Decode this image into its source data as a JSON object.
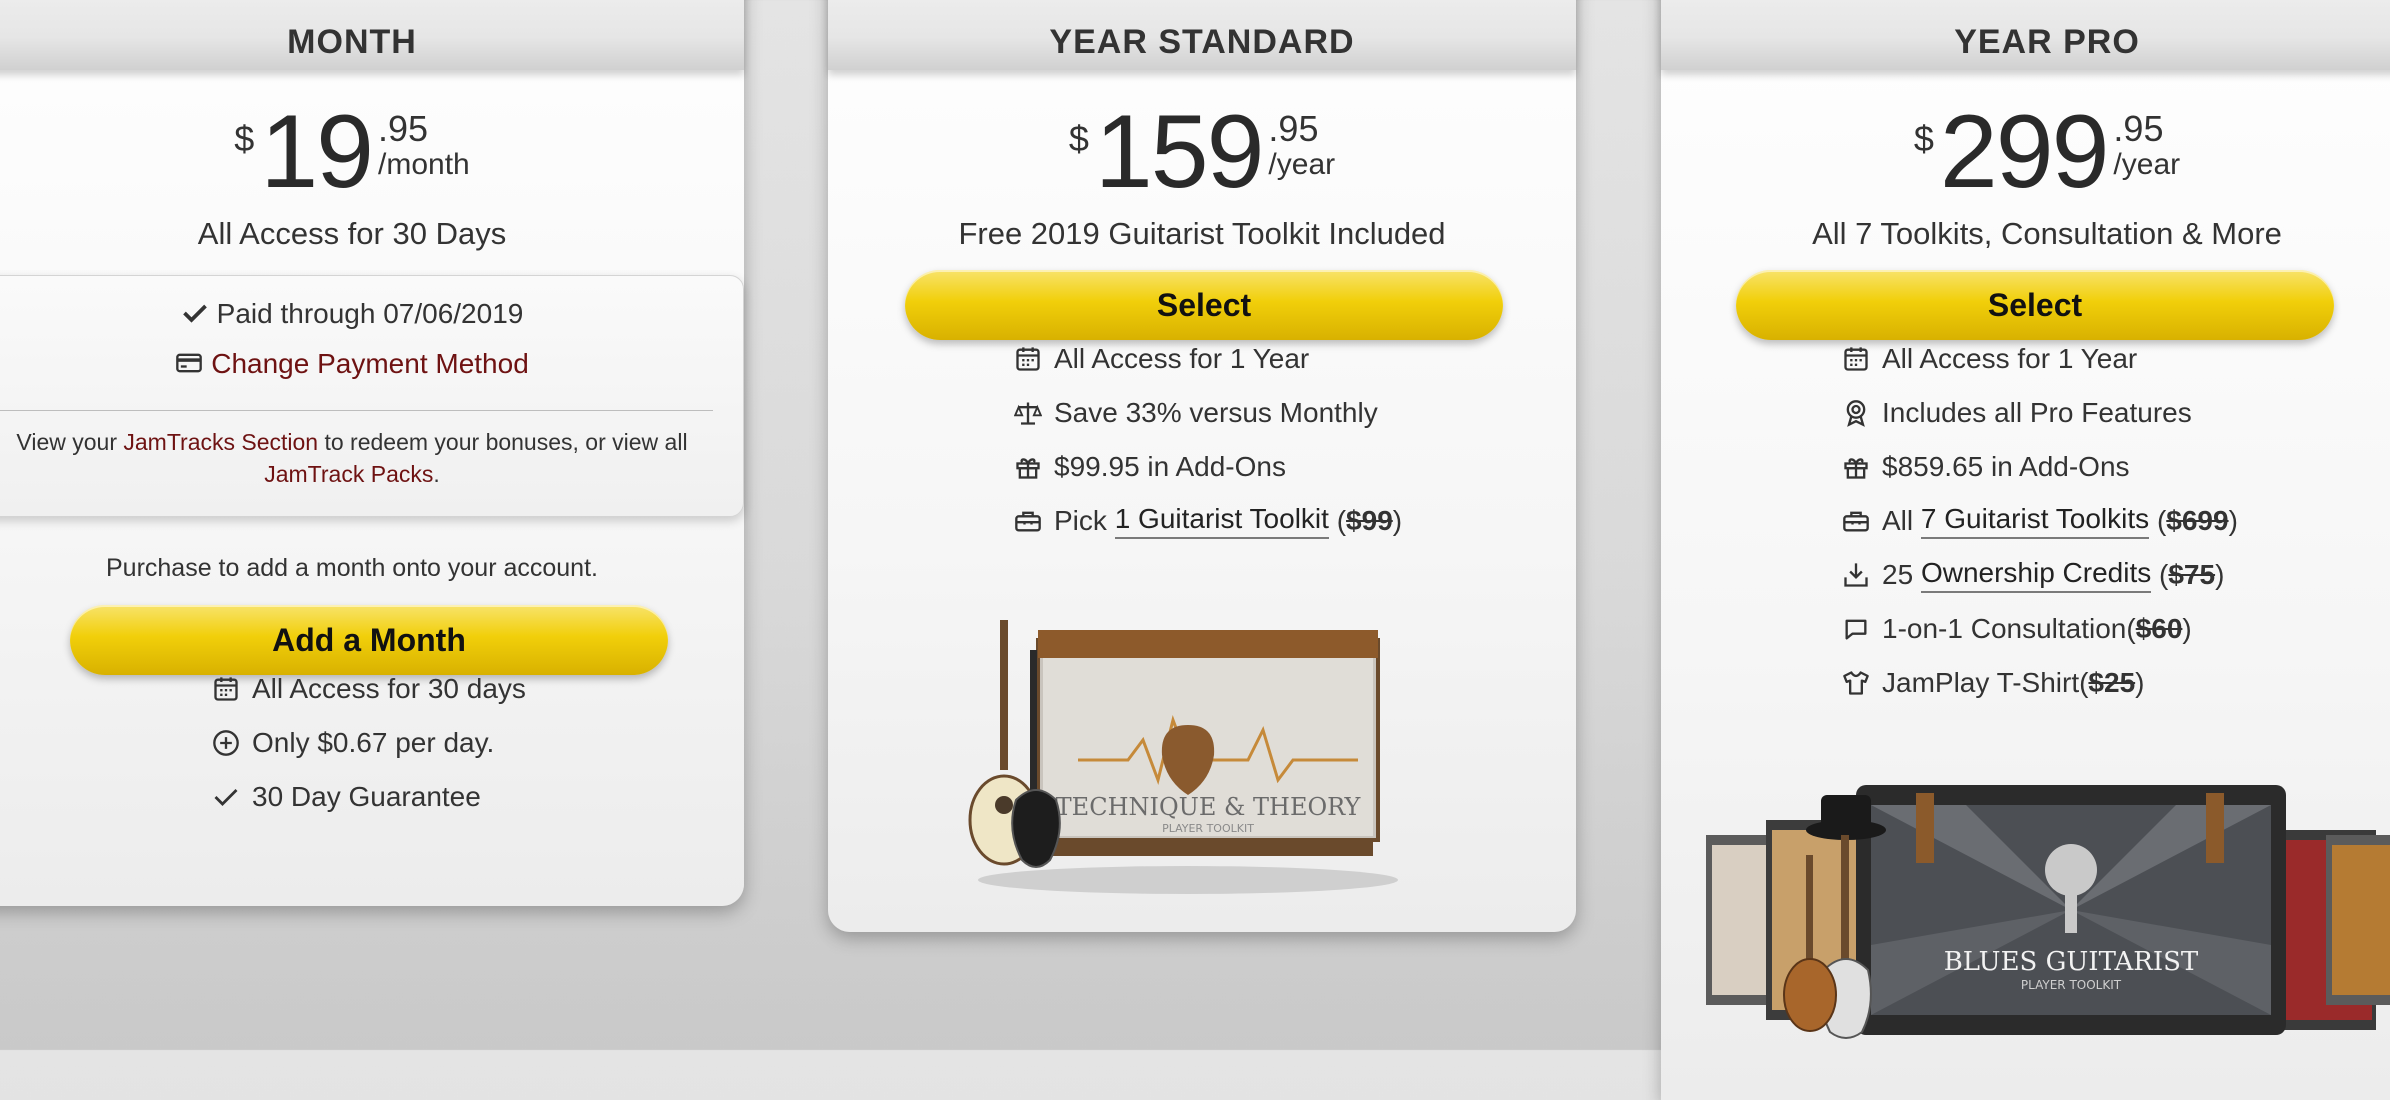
{
  "month": {
    "title": "MONTH",
    "currency": "$",
    "price_whole": "19",
    "price_cents": ".95",
    "period": "/month",
    "subtitle": "All Access for 30 Days",
    "paid_through": "Paid through 07/06/2019",
    "change_payment": "Change Payment Method",
    "note_prefix": "View your ",
    "note_link1": "JamTracks Section",
    "note_mid": " to redeem your bonuses, or view all ",
    "note_link2": "JamTrack Packs",
    "note_suffix": ".",
    "purchase_text": "Purchase to add a month onto your account.",
    "button": "Add a Month",
    "features": [
      {
        "icon": "calendar-icon",
        "text": "All Access for 30 days"
      },
      {
        "icon": "plus-circle-icon",
        "text": "Only $0.67 per day."
      },
      {
        "icon": "check-icon",
        "text": "30 Day Guarantee"
      }
    ]
  },
  "standard": {
    "title": "YEAR STANDARD",
    "currency": "$",
    "price_whole": "159",
    "price_cents": ".95",
    "period": "/year",
    "subtitle": "Free 2019 Guitarist Toolkit Included",
    "button": "Select",
    "features": {
      "f1": "All Access for 1 Year",
      "f2": "Save 33% versus Monthly",
      "f3": "$99.95 in Add-Ons",
      "f4_prefix": "Pick ",
      "f4_link": "1 Guitarist Toolkit",
      "f4_price": "$99"
    },
    "toolkit_title": "TECHNIQUE & THEORY",
    "toolkit_subtitle": "PLAYER TOOLKIT"
  },
  "pro": {
    "title": "YEAR PRO",
    "currency": "$",
    "price_whole": "299",
    "price_cents": ".95",
    "period": "/year",
    "subtitle": "All 7 Toolkits, Consultation & More",
    "button": "Select",
    "features": {
      "f1": "All Access for 1 Year",
      "f2": "Includes all Pro Features",
      "f3": "$859.65 in Add-Ons",
      "f4_prefix": "All ",
      "f4_link": "7 Guitarist Toolkits",
      "f4_price": "$699",
      "f5_prefix": "25 ",
      "f5_link": "Ownership Credits",
      "f5_price": "$75",
      "f6_prefix": "1-on-1 Consultation ",
      "f6_price": "$60",
      "f7_prefix": "JamPlay T-Shirt ",
      "f7_price": "$25"
    },
    "toolkit_title": "BLUES GUITARIST",
    "toolkit_subtitle": "PLAYER TOOLKIT"
  },
  "colors": {
    "gold": "#f1cf0a",
    "link_dark_red": "#6e1212"
  }
}
